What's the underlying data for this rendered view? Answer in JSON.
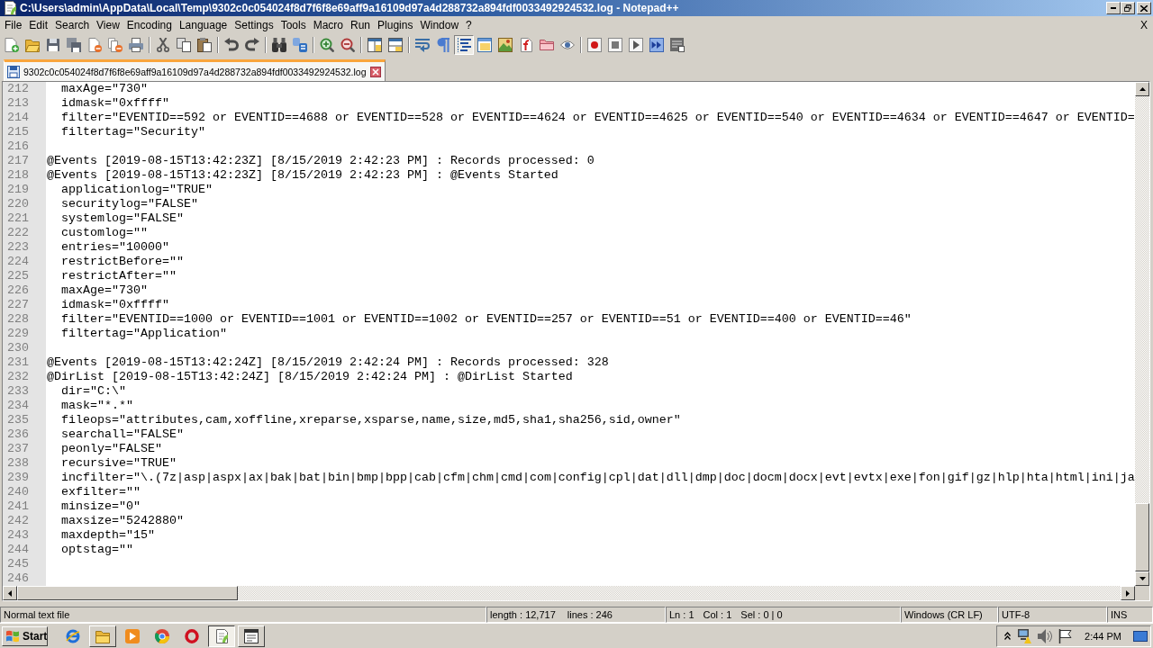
{
  "window": {
    "title": "C:\\Users\\admin\\AppData\\Local\\Temp\\9302c0c054024f8d7f6f8e69aff9a16109d97a4d288732a894fdf0033492924532.log - Notepad++"
  },
  "menu": {
    "items": [
      "File",
      "Edit",
      "Search",
      "View",
      "Encoding",
      "Language",
      "Settings",
      "Tools",
      "Macro",
      "Run",
      "Plugins",
      "Window",
      "?"
    ],
    "close_label": "X"
  },
  "toolbar": {
    "buttons": [
      {
        "pressed": false
      },
      {
        "pressed": false
      },
      {
        "pressed": false
      },
      {
        "pressed": false
      },
      {
        "pressed": false
      },
      {
        "pressed": false
      },
      {
        "pressed": false
      },
      {
        "pressed": false
      },
      {
        "pressed": false
      },
      {
        "pressed": false
      },
      {
        "pressed": false
      },
      {
        "pressed": false
      },
      {
        "pressed": false
      },
      {
        "pressed": false
      },
      {
        "pressed": false
      },
      {
        "pressed": false
      },
      {
        "pressed": false
      },
      {
        "pressed": false
      },
      {
        "pressed": false
      },
      {
        "pressed": false
      },
      {
        "pressed": true
      },
      {
        "pressed": false
      },
      {
        "pressed": false
      },
      {
        "pressed": false
      },
      {
        "pressed": false
      },
      {
        "pressed": false
      },
      {
        "pressed": false
      },
      {
        "pressed": false
      },
      {
        "pressed": false
      },
      {
        "pressed": false
      },
      {
        "pressed": false
      }
    ]
  },
  "tabs": [
    {
      "label": "9302c0c054024f8d7f6f8e69aff9a16109d97a4d288732a894fdf0033492924532.log",
      "selected": true
    }
  ],
  "editor": {
    "lines": [
      {
        "number": "212",
        "kind": "property",
        "text": "maxAge=\"730\""
      },
      {
        "number": "213",
        "kind": "property",
        "text": "idmask=\"0xffff\""
      },
      {
        "number": "214",
        "kind": "property",
        "text": "filter=\"EVENTID==592 or EVENTID==4688 or EVENTID==528 or EVENTID==4624 or EVENTID==4625 or EVENTID==540 or EVENTID==4634 or EVENTID==4647 or EVENTID="
      },
      {
        "number": "215",
        "kind": "property",
        "text": "filtertag=\"Security\""
      },
      {
        "number": "216",
        "kind": "blank"
      },
      {
        "number": "217",
        "kind": "event",
        "text": "@Events [2019-08-15T13:42:23Z] [8/15/2019 2:42:23 PM] : Records processed: 0"
      },
      {
        "number": "218",
        "kind": "event",
        "text": "@Events [2019-08-15T13:42:23Z] [8/15/2019 2:42:23 PM] : @Events Started"
      },
      {
        "number": "219",
        "kind": "property",
        "text": "applicationlog=\"TRUE\""
      },
      {
        "number": "220",
        "kind": "property",
        "text": "securitylog=\"FALSE\""
      },
      {
        "number": "221",
        "kind": "property",
        "text": "systemlog=\"FALSE\""
      },
      {
        "number": "222",
        "kind": "property",
        "text": "customlog=\"\""
      },
      {
        "number": "223",
        "kind": "property",
        "text": "entries=\"10000\""
      },
      {
        "number": "224",
        "kind": "property",
        "text": "restrictBefore=\"\""
      },
      {
        "number": "225",
        "kind": "property",
        "text": "restrictAfter=\"\""
      },
      {
        "number": "226",
        "kind": "property",
        "text": "maxAge=\"730\""
      },
      {
        "number": "227",
        "kind": "property",
        "text": "idmask=\"0xffff\""
      },
      {
        "number": "228",
        "kind": "property",
        "text": "filter=\"EVENTID==1000 or EVENTID==1001 or EVENTID==1002 or EVENTID==257 or EVENTID==51 or EVENTID==400 or EVENTID==46\""
      },
      {
        "number": "229",
        "kind": "property",
        "text": "filtertag=\"Application\""
      },
      {
        "number": "230",
        "kind": "blank"
      },
      {
        "number": "231",
        "kind": "event",
        "text": "@Events [2019-08-15T13:42:24Z] [8/15/2019 2:42:24 PM] : Records processed: 328"
      },
      {
        "number": "232",
        "kind": "event",
        "text": "@DirList [2019-08-15T13:42:24Z] [8/15/2019 2:42:24 PM] : @DirList Started"
      },
      {
        "number": "233",
        "kind": "property",
        "text": "dir=\"C:\\\""
      },
      {
        "number": "234",
        "kind": "property",
        "text": "mask=\"*.*\""
      },
      {
        "number": "235",
        "kind": "property",
        "text": "fileops=\"attributes,cam,xoffline,xreparse,xsparse,name,size,md5,sha1,sha256,sid,owner\""
      },
      {
        "number": "236",
        "kind": "property",
        "text": "searchall=\"FALSE\""
      },
      {
        "number": "237",
        "kind": "property",
        "text": "peonly=\"FALSE\""
      },
      {
        "number": "238",
        "kind": "property",
        "text": "recursive=\"TRUE\""
      },
      {
        "number": "239",
        "kind": "property",
        "text": "incfilter=\"\\.(7z|asp|aspx|ax|bak|bat|bin|bmp|bpp|cab|cfm|chm|cmd|com|config|cpl|dat|dll|dmp|doc|docm|docx|evt|evtx|exe|fon|gif|gz|hlp|hta|html|ini|ja"
      },
      {
        "number": "240",
        "kind": "property",
        "text": "exfilter=\"\""
      },
      {
        "number": "241",
        "kind": "property",
        "text": "minsize=\"0\""
      },
      {
        "number": "242",
        "kind": "property",
        "text": "maxsize=\"5242880\""
      },
      {
        "number": "243",
        "kind": "property",
        "text": "maxdepth=\"15\""
      },
      {
        "number": "244",
        "kind": "property",
        "text": "optstag=\"\""
      },
      {
        "number": "245",
        "kind": "blank"
      },
      {
        "number": "246",
        "kind": "blank"
      }
    ]
  },
  "status_bar": {
    "panels": [
      {
        "texts": [
          "Normal text file"
        ]
      },
      {
        "texts": [
          "length : 12,717",
          "lines : 246"
        ]
      },
      {
        "texts": [
          "Ln : 1",
          "Col : 1",
          "Sel : 0 | 0"
        ]
      },
      {
        "texts": [
          "Windows (CR LF)"
        ]
      },
      {
        "texts": [
          "UTF-8"
        ]
      },
      {
        "texts": [
          "INS"
        ]
      }
    ]
  },
  "taskbar": {
    "start": "Start",
    "apps": [
      {
        "open": false,
        "selected": false
      },
      {
        "open": true,
        "selected": false
      },
      {
        "open": false,
        "selected": false
      },
      {
        "open": false,
        "selected": false
      },
      {
        "open": false,
        "selected": false
      },
      {
        "open": true,
        "selected": true
      },
      {
        "open": true,
        "selected": false
      }
    ],
    "clock": "2:44 PM"
  }
}
